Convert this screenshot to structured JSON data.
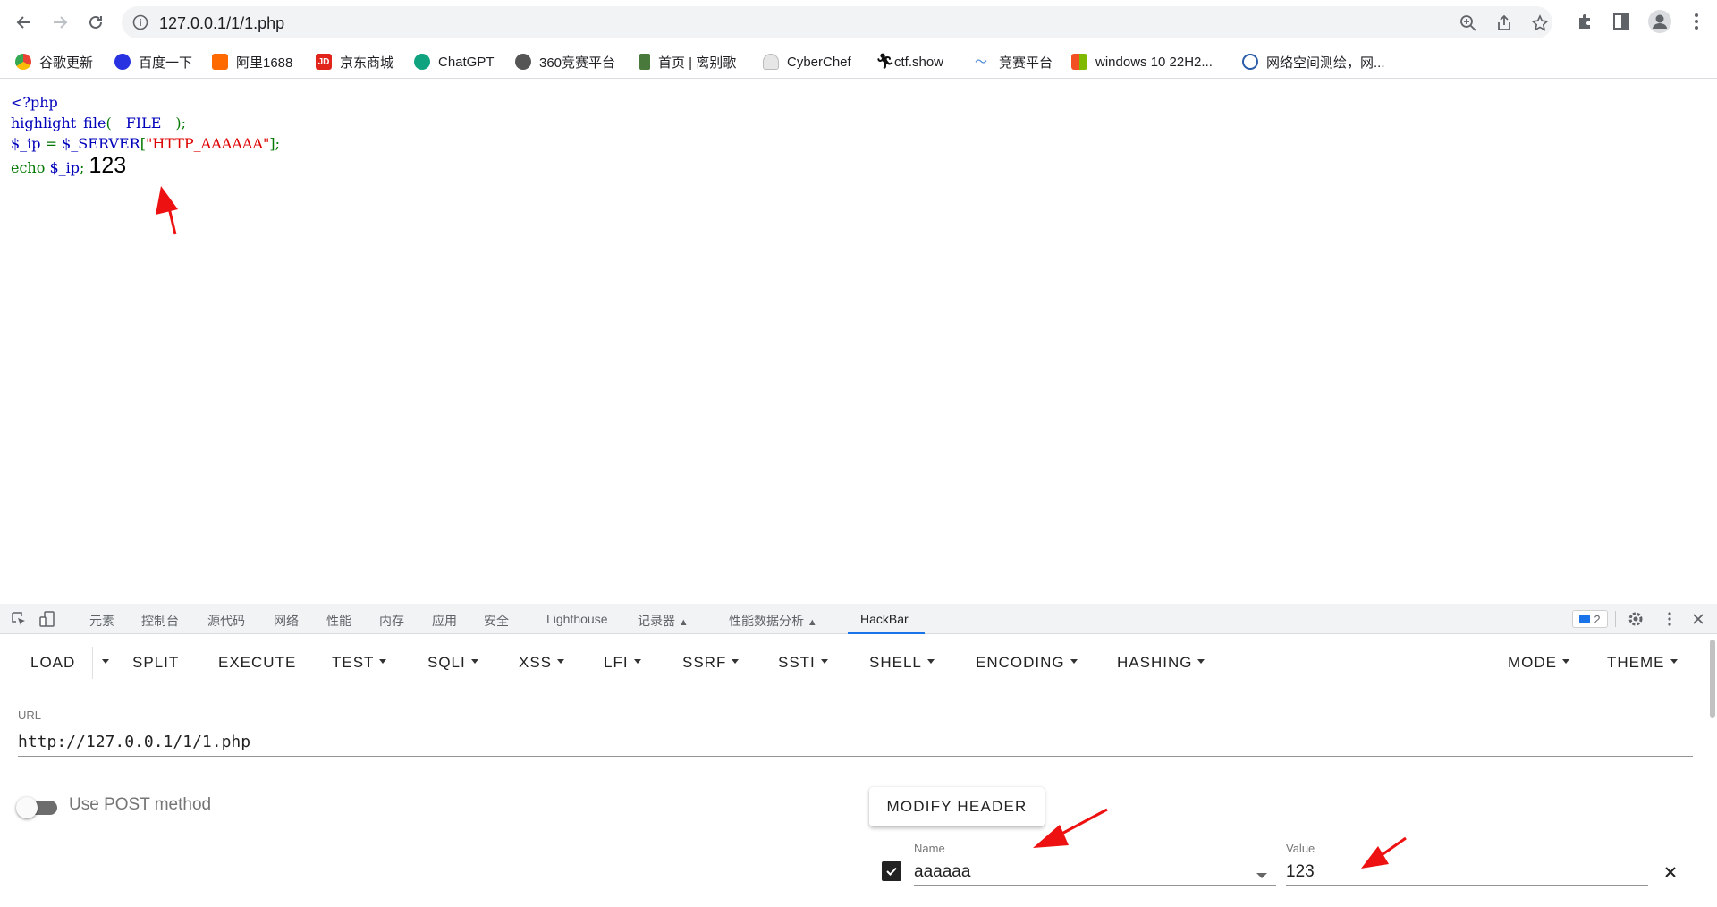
{
  "browser": {
    "url": "127.0.0.1/1/1.php"
  },
  "bookmarks": [
    {
      "label": "谷歌更新",
      "color": "#4285f4"
    },
    {
      "label": "百度一下",
      "color": "#2932e1"
    },
    {
      "label": "阿里1688",
      "color": "#ff6a00"
    },
    {
      "label": "京东商城",
      "color": "#e1251b"
    },
    {
      "label": "ChatGPT",
      "color": "#10a37f"
    },
    {
      "label": "360竞赛平台",
      "color": "#555555"
    },
    {
      "label": "首页 | 离别歌",
      "color": "#4a7a3b"
    },
    {
      "label": "CyberChef",
      "color": "#bbbbbb"
    },
    {
      "label": "ctf.show",
      "color": "#111111"
    },
    {
      "label": "竞赛平台",
      "color": "#4d88d6"
    },
    {
      "label": "windows 10 22H2...",
      "color": "#e0431b"
    },
    {
      "label": "网络空间测绘，网...",
      "color": "#2a5caa"
    }
  ],
  "page": {
    "code": {
      "l1": "<?php",
      "l2_fn": "highlight_file",
      "l2_open": "(",
      "l2_const": "__FILE__",
      "l2_close": ");",
      "l3_var": "$_ip",
      "l3_eq": " = ",
      "l3_server": "$_SERVER",
      "l3_lb": "[",
      "l3_key": "\"HTTP_AAAAAA\"",
      "l3_rb": "];",
      "l4_echo": "echo ",
      "l4_var": "$_ip",
      "l4_semi": ";"
    },
    "output": "123"
  },
  "devtools": {
    "tabs": [
      "元素",
      "控制台",
      "源代码",
      "网络",
      "性能",
      "内存",
      "应用",
      "安全",
      "Lighthouse",
      "记录器",
      "性能数据分析",
      "HackBar"
    ],
    "active_tab": "HackBar",
    "issues_count": "2"
  },
  "hackbar": {
    "menu": {
      "load": "LOAD",
      "split": "SPLIT",
      "execute": "EXECUTE",
      "test": "TEST",
      "sqli": "SQLI",
      "xss": "XSS",
      "lfi": "LFI",
      "ssrf": "SSRF",
      "ssti": "SSTI",
      "shell": "SHELL",
      "encoding": "ENCODING",
      "hashing": "HASHING",
      "mode": "MODE",
      "theme": "THEME"
    },
    "url_label": "URL",
    "url_value": "http://127.0.0.1/1/1.php",
    "post_label": "Use POST method",
    "post_enabled": false,
    "modify_header_label": "MODIFY HEADER",
    "header": {
      "enabled": true,
      "name_label": "Name",
      "name_value": "aaaaaa",
      "value_label": "Value",
      "value_value": "123"
    }
  },
  "colors": {
    "annotation_arrow": "#ee1111",
    "active_tab_underline": "#1a73e8"
  }
}
